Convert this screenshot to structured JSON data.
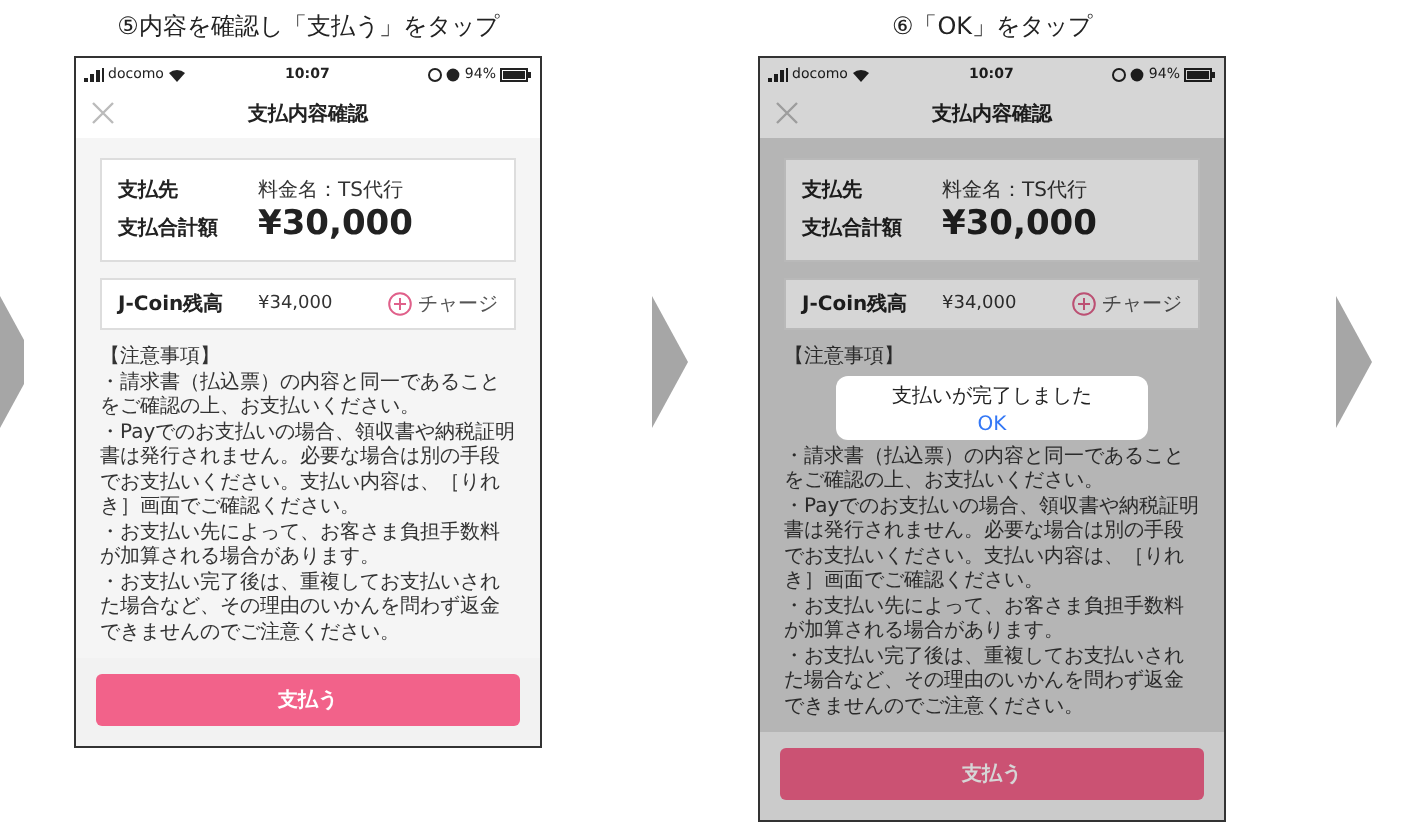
{
  "steps": [
    {
      "caption": "⑤内容を確認し「支払う」をタップ",
      "dimmed": false,
      "phone": {
        "carrier": "docomo",
        "time": "10:07",
        "battery": "94%",
        "title": "支払内容確認",
        "payee_label": "支払先",
        "total_label": "支払合計額",
        "payee": "料金名：TS代行",
        "amount": "¥30,000",
        "balance_label": "J-Coin残高",
        "balance": "¥34,000",
        "charge": "チャージ",
        "notes_heading": "【注意事項】",
        "notes": [
          "・請求書（払込票）の内容と同一であることをご確認の上、お支払いください。",
          "・Payでのお支払いの場合、領収書や納税証明書は発行されません。必要な場合は別の手段でお支払いください。支払い内容は、［りれき］画面でご確認ください。",
          "・お支払い先によって、お客さま負担手数料が加算される場合があります。",
          "・お支払い完了後は、重複してお支払いされた場合など、その理由のいかんを問わず返金できませんのでご注意ください。"
        ],
        "pay_button": "支払う"
      }
    },
    {
      "caption": "⑥「OK」をタップ",
      "dimmed": true,
      "phone": {
        "carrier": "docomo",
        "time": "10:07",
        "battery": "94%",
        "title": "支払内容確認",
        "payee_label": "支払先",
        "total_label": "支払合計額",
        "payee": "料金名：TS代行",
        "amount": "¥30,000",
        "balance_label": "J-Coin残高",
        "balance": "¥34,000",
        "charge": "チャージ",
        "notes_heading": "【注意事項】",
        "notes": [
          "・請求書（払込票）の内容と同一であることをご確認の上、お支払いください。",
          "・Payでのお支払いの場合、領収書や納税証明書は発行されません。必要な場合は別の手段でお支払いください。支払い内容は、［りれき］画面でご確認ください。",
          "・お支払い先によって、お客さま負担手数料が加算される場合があります。",
          "・お支払い完了後は、重複してお支払いされた場合など、その理由のいかんを問わず返金できませんのでご注意ください。"
        ],
        "pay_button": "支払う"
      },
      "dialog": {
        "message": "支払いが完了しました",
        "button": "OK"
      }
    }
  ]
}
